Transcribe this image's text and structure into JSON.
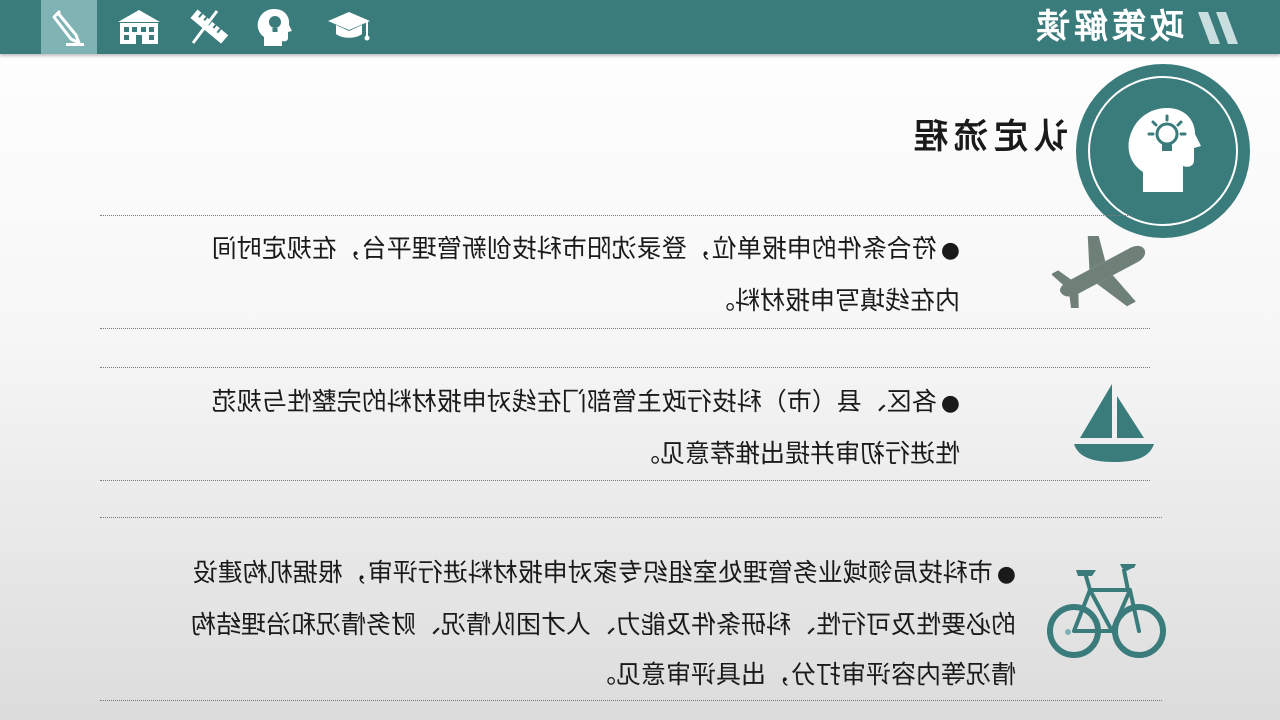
{
  "header": {
    "title": "政策解读",
    "nav_icons": [
      "pencil-icon",
      "school-icon",
      "ruler-icon",
      "head-idea-icon",
      "graduation-cap-icon"
    ],
    "colors": {
      "bar": "#3a7b7c",
      "active_tab": "#7fb3b4",
      "text": "#1a1a1a",
      "badge": "#3a7b7c"
    }
  },
  "section": {
    "heading": "认定流程",
    "badge_icon": "head-idea-icon"
  },
  "items": [
    {
      "bullet": "●",
      "line1": "符合条件的申报单位，登录沈阳市科技创新管理平台，在规定时间",
      "line2": "内在线填写申报材料。",
      "icon": "airplane-icon"
    },
    {
      "bullet": "●",
      "line1": "各区、县（市）科技行政主管部门在线对申报材料的完整性与规范",
      "line2": "性进行初审并提出推荐意见。",
      "icon": "sailboat-icon"
    },
    {
      "bullet": "●",
      "line1": "市科技局领域业务管理处室组织专家对申报材料进行评审，根据机构建设",
      "line2": "的必要性及可行性、科研条件及能力、人才团队情况、财务情况和治理结构",
      "line3": "情况等内容评审打分，出具评审意见。",
      "icon": "bicycle-icon"
    }
  ]
}
